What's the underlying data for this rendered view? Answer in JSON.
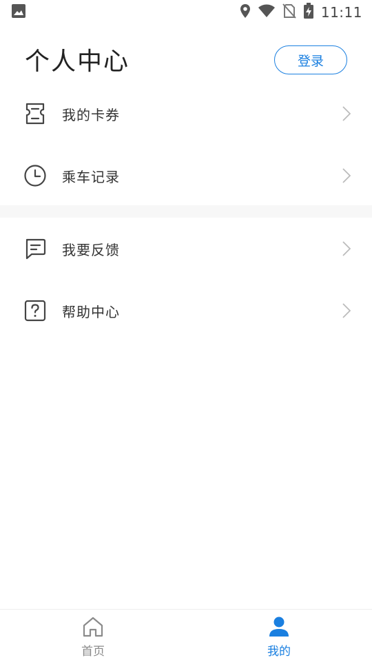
{
  "status_bar": {
    "time": "11:11",
    "icons": [
      "image-icon",
      "location-icon",
      "wifi-icon",
      "no-sim-icon",
      "battery-charging-icon"
    ]
  },
  "header": {
    "title": "个人中心",
    "login_label": "登录"
  },
  "menu": {
    "group1": [
      {
        "label": "我的卡券",
        "icon": "ticket-icon"
      },
      {
        "label": "乘车记录",
        "icon": "clock-icon"
      }
    ],
    "group2": [
      {
        "label": "我要反馈",
        "icon": "feedback-icon"
      },
      {
        "label": "帮助中心",
        "icon": "help-icon"
      }
    ]
  },
  "tab_bar": {
    "tabs": [
      {
        "label": "首页",
        "icon": "home-icon",
        "active": false
      },
      {
        "label": "我的",
        "icon": "person-icon",
        "active": true
      }
    ]
  },
  "colors": {
    "accent": "#1a7fe0",
    "inactive": "#8a8a8a",
    "text": "#333333"
  }
}
